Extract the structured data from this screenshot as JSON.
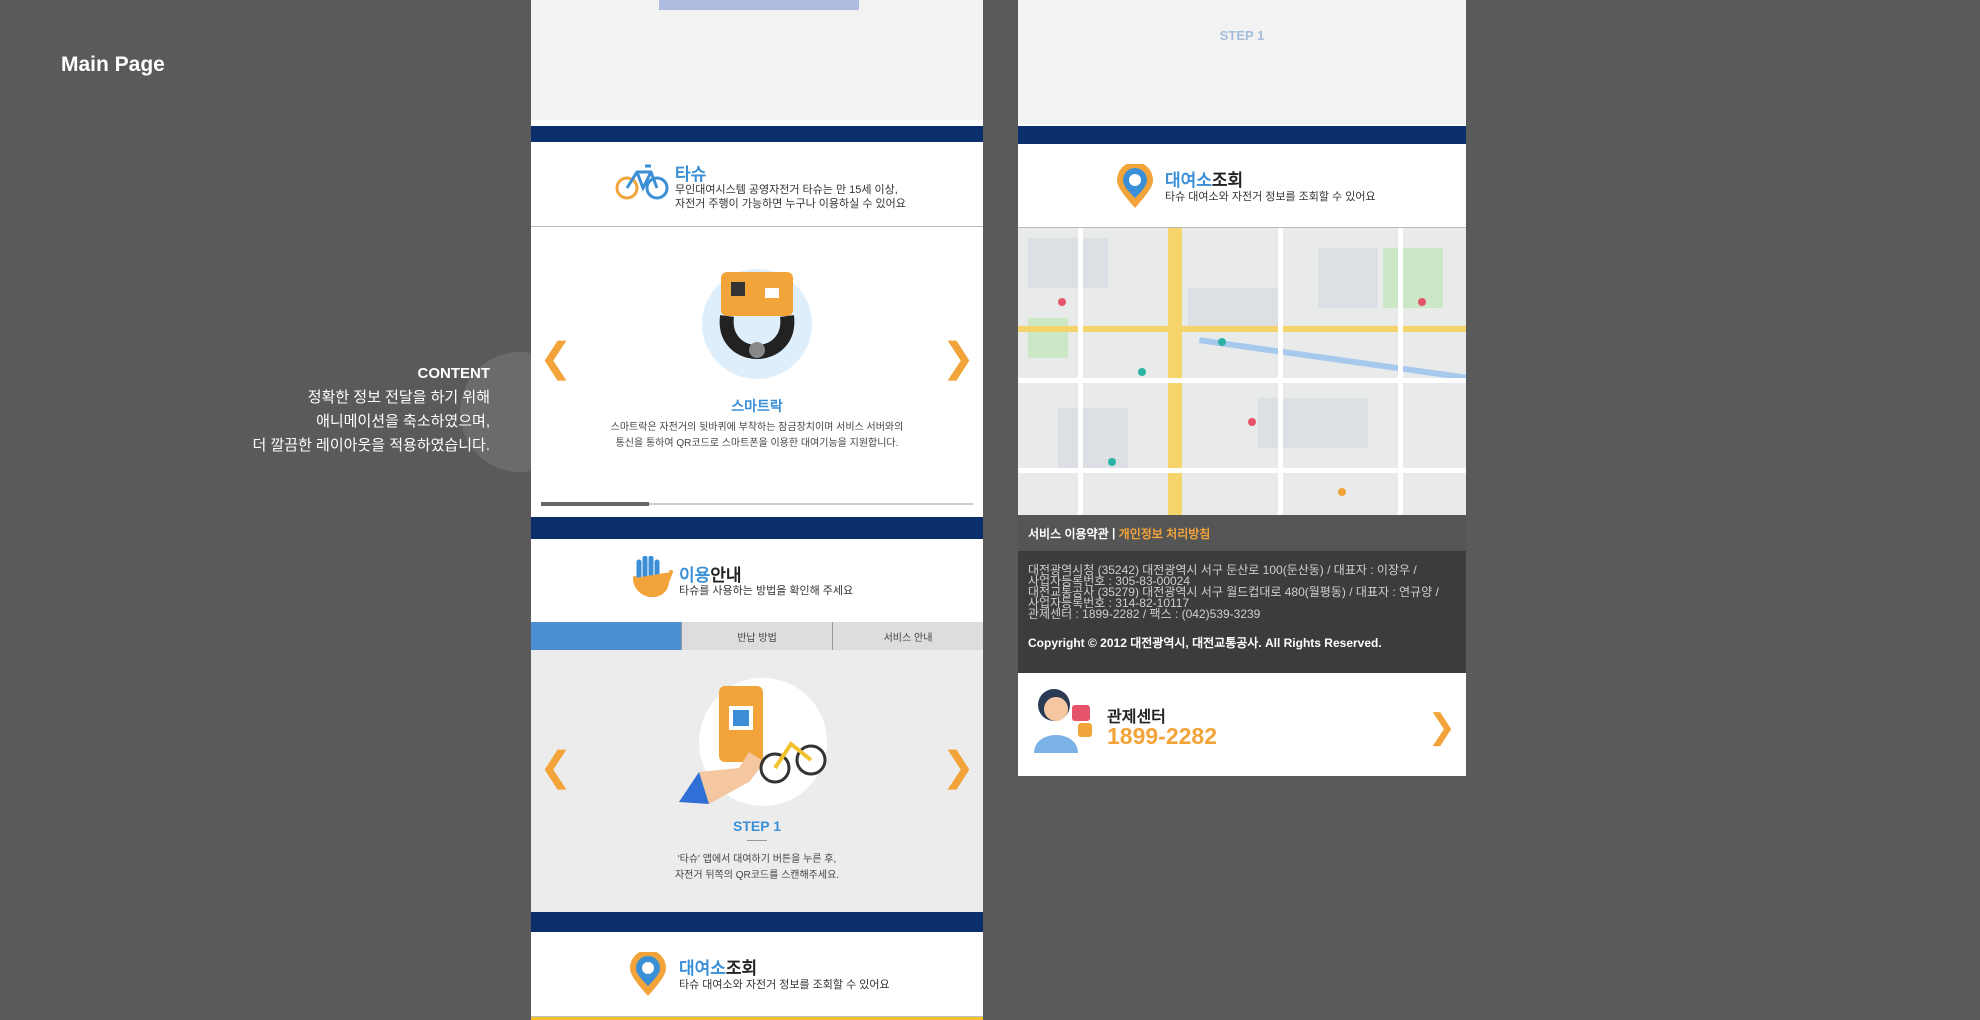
{
  "page_label": "Main Page",
  "content_note": {
    "title": "CONTENT",
    "lines": [
      "정확한 정보 전달을 하기 위해",
      "애니메이션을 축소하였으며,",
      "더 깔끔한 레이아웃을 적용하였습니다."
    ]
  },
  "left_column": {
    "tashu": {
      "title_blue": "타슈",
      "desc_line1": "무인대여시스템 공영자전거 타슈는 만 15세 이상,",
      "desc_line2": "자전거 주행이 가능하면 누구나 이용하실 수 있어요",
      "slide_title": "스마트락",
      "slide_desc_line1": "스마트락은 자전거의 뒷바퀴에 부착하는 잠금장치이며 서비스 서버와의",
      "slide_desc_line2": "통신을 통하여 QR코드로 스마트폰을 이용한 대여기능을 지원합니다.",
      "progress": 0.25
    },
    "usage": {
      "title_blue": "이용",
      "title_rest": "안내",
      "desc": "타슈를 사용하는 방법을 확인해 주세요",
      "tabs": [
        "",
        "반납 방법",
        "서비스 안내"
      ],
      "step_title": "STEP 1",
      "step_desc_line1": "'타슈' 앱에서 대여하기 버튼을 누른 후,",
      "step_desc_line2": "자전거 뒤쪽의 QR코드를 스캔해주세요."
    },
    "rental": {
      "title_blue": "대여소",
      "title_rest": "조회",
      "desc": "타슈 대여소와 자전거 정보를 조회할 수 있어요"
    }
  },
  "right_column": {
    "faded_step": "STEP 1",
    "rental": {
      "title_blue": "대여소",
      "title_rest": "조회",
      "desc": "타슈 대여소와 자전거 정보를 조회할 수 있어요"
    },
    "footer": {
      "terms": "서비스 이용약관",
      "separator": " | ",
      "privacy": "개인정보 처리방침",
      "info_lines": [
        "대전광역시청 (35242) 대전광역시 서구 둔산로 100(둔산동) / 대표자 : 이장우 /",
        "사업자등록번호 : 305-83-00024",
        "대전교통공사 (35279) 대전광역시 서구 월드컵대로 480(월평동) / 대표자 : 연규양 /",
        "사업자등록번호 : 314-82-10117",
        "관제센터 : 1899-2282 / 팩스 : (042)539-3239"
      ],
      "copyright": "Copyright © 2012 대전광역시, 대전교통공사. All Rights Reserved."
    },
    "call_center": {
      "label": "관제센터",
      "phone": "1899-2282"
    }
  },
  "colors": {
    "accent_blue": "#3a8fd6",
    "accent_orange": "#f2a43a",
    "navy": "#0a2f6b",
    "background": "#5a5a5a"
  }
}
